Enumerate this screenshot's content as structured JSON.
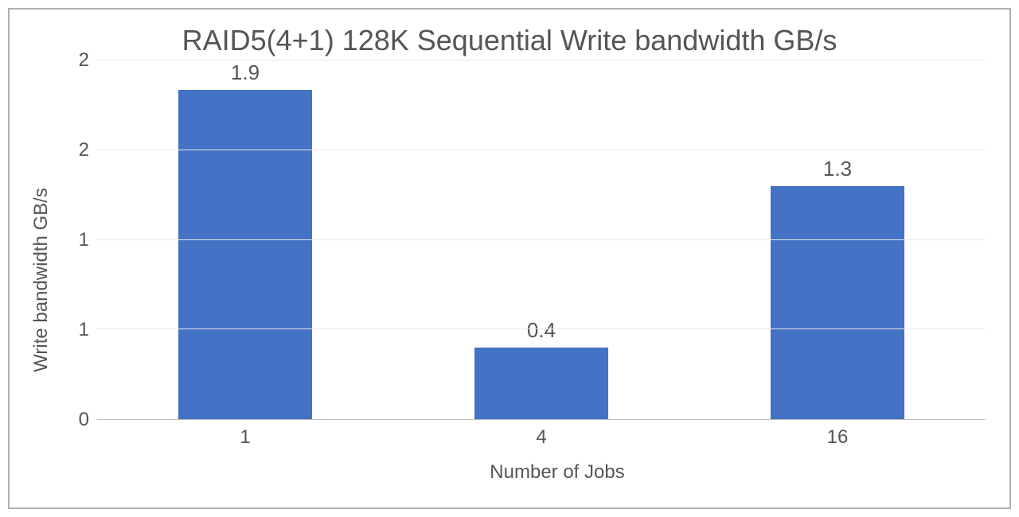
{
  "chart_data": {
    "type": "bar",
    "title": "RAID5(4+1) 128K Sequential Write bandwidth GB/s",
    "xlabel": "Number of Jobs",
    "ylabel": "Write bandwidth GB/s",
    "categories": [
      "1",
      "4",
      "16"
    ],
    "values": [
      1.9,
      0.4,
      1.3
    ],
    "value_labels": [
      "1.9",
      "0.4",
      "1.3"
    ],
    "ylim": [
      0,
      2
    ],
    "yticks": [
      "0",
      "1",
      "1",
      "2",
      "2"
    ],
    "ytick_values": [
      0,
      0.5,
      1.0,
      1.5,
      2.0
    ],
    "bar_color": "#4472c4"
  }
}
